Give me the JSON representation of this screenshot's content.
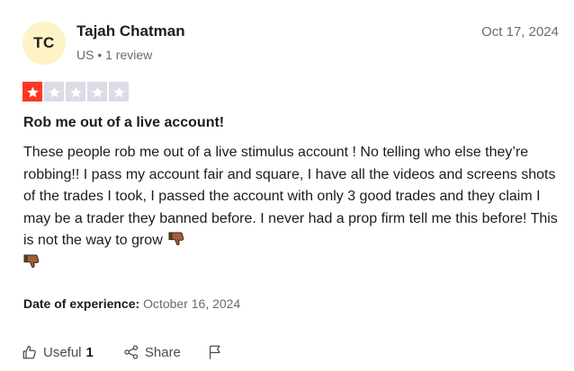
{
  "reviewer": {
    "initials": "TC",
    "name": "Tajah Chatman",
    "meta": "US • 1 review"
  },
  "review": {
    "date": "Oct 17, 2024",
    "rating": 1,
    "rating_max": 5,
    "title": "Rob me out of a live account!",
    "body": "These people rob me out of a live stimulus account ! No telling who else they’re robbing!! I pass my account fair and square, I have all the videos and screens shots of the trades I took, I passed the account with only 3 good trades and they claim I may be a trader they banned before. I never had a prop firm tell me this before! This is not the way to grow",
    "emojis": [
      "thumbs-down-emoji",
      "thumbs-down-emoji"
    ],
    "experience_label": "Date of experience:",
    "experience_date": "October 16, 2024"
  },
  "actions": {
    "useful_label": "Useful",
    "useful_count": "1",
    "share_label": "Share",
    "flag_icon": "flag-icon"
  },
  "colors": {
    "star_active": "#ff3722",
    "star_inactive": "#dcdce6",
    "avatar_bg": "#fdf3c6"
  }
}
